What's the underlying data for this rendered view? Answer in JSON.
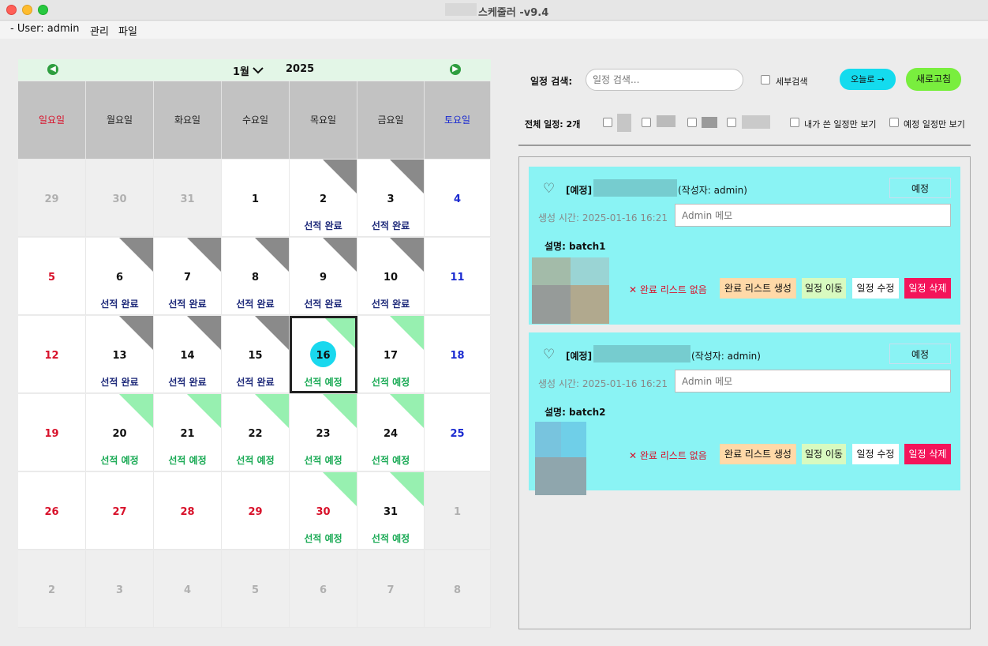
{
  "window": {
    "title": "스케줄러 -v9.4"
  },
  "menu": {
    "user": "- User: admin",
    "manage": "관리",
    "file": "파일"
  },
  "calendar": {
    "month": "1월",
    "year": "2025",
    "weekdays": [
      "일요일",
      "월요일",
      "화요일",
      "수요일",
      "목요일",
      "금요일",
      "토요일"
    ],
    "weeks": [
      [
        {
          "d": "29",
          "m": "other"
        },
        {
          "d": "30",
          "m": "other"
        },
        {
          "d": "31",
          "m": "other"
        },
        {
          "d": "1",
          "m": "cur"
        },
        {
          "d": "2",
          "m": "cur",
          "s": "선적 완료"
        },
        {
          "d": "3",
          "m": "cur",
          "s": "선적 완료"
        },
        {
          "d": "4",
          "m": "cur"
        }
      ],
      [
        {
          "d": "5",
          "m": "cur"
        },
        {
          "d": "6",
          "m": "cur",
          "s": "선적 완료"
        },
        {
          "d": "7",
          "m": "cur",
          "s": "선적 완료"
        },
        {
          "d": "8",
          "m": "cur",
          "s": "선적 완료"
        },
        {
          "d": "9",
          "m": "cur",
          "s": "선적 완료"
        },
        {
          "d": "10",
          "m": "cur",
          "s": "선적 완료"
        },
        {
          "d": "11",
          "m": "cur"
        }
      ],
      [
        {
          "d": "12",
          "m": "cur"
        },
        {
          "d": "13",
          "m": "cur",
          "s": "선적 완료"
        },
        {
          "d": "14",
          "m": "cur",
          "s": "선적 완료"
        },
        {
          "d": "15",
          "m": "cur",
          "s": "선적 완료"
        },
        {
          "d": "16",
          "m": "cur",
          "s": "선적 예정",
          "today": true
        },
        {
          "d": "17",
          "m": "cur",
          "s": "선적 예정"
        },
        {
          "d": "18",
          "m": "cur"
        }
      ],
      [
        {
          "d": "19",
          "m": "cur"
        },
        {
          "d": "20",
          "m": "cur",
          "s": "선적 예정"
        },
        {
          "d": "21",
          "m": "cur",
          "s": "선적 예정"
        },
        {
          "d": "22",
          "m": "cur",
          "s": "선적 예정"
        },
        {
          "d": "23",
          "m": "cur",
          "s": "선적 예정"
        },
        {
          "d": "24",
          "m": "cur",
          "s": "선적 예정"
        },
        {
          "d": "25",
          "m": "cur"
        }
      ],
      [
        {
          "d": "26",
          "m": "cur",
          "red": true
        },
        {
          "d": "27",
          "m": "cur",
          "red": true
        },
        {
          "d": "28",
          "m": "cur",
          "red": true
        },
        {
          "d": "29",
          "m": "cur",
          "red": true
        },
        {
          "d": "30",
          "m": "cur",
          "red": true,
          "s": "선적 예정"
        },
        {
          "d": "31",
          "m": "cur",
          "s": "선적 예정"
        },
        {
          "d": "1",
          "m": "other"
        }
      ],
      [
        {
          "d": "2",
          "m": "other"
        },
        {
          "d": "3",
          "m": "other"
        },
        {
          "d": "4",
          "m": "other"
        },
        {
          "d": "5",
          "m": "other"
        },
        {
          "d": "6",
          "m": "other"
        },
        {
          "d": "7",
          "m": "other"
        },
        {
          "d": "8",
          "m": "other"
        }
      ]
    ],
    "colors": {
      "done_text": "#1e2a7a",
      "plan_text": "#1aaa55",
      "done_corner": "#8a8a8a",
      "plan_corner": "#97f0b0",
      "today": "#19d8ee"
    }
  },
  "search": {
    "label": "일정 검색:",
    "placeholder": "일정 검색...",
    "detail_label": "세부검색",
    "today_button": "오늘로 →",
    "refresh_button": "새로고침"
  },
  "filters": {
    "total": "전체 일정: 2개",
    "mine_label": "내가 쓴 일정만 보기",
    "planned_label": "예정 일정만 보기"
  },
  "cards": [
    {
      "tag": "[예정]",
      "author": "(작성자: admin)",
      "status": "예정",
      "created": "생성 시간: 2025-01-16 16:21",
      "memo_placeholder": "Admin 메모",
      "desc": "설명: batch1",
      "no_list": "✕ 완료 리스트 없음",
      "btn_create": "완료 리스트 생성",
      "btn_move": "일정 이동",
      "btn_edit": "일정 수정",
      "btn_delete": "일정 삭제"
    },
    {
      "tag": "[예정]",
      "author": "(작성자: admin)",
      "status": "예정",
      "created": "생성 시간: 2025-01-16 16:21",
      "memo_placeholder": "Admin 메모",
      "desc": "설명: batch2",
      "no_list": "✕ 완료 리스트 없음",
      "btn_create": "완료 리스트 생성",
      "btn_move": "일정 이동",
      "btn_edit": "일정 수정",
      "btn_delete": "일정 삭제"
    }
  ],
  "icons": {
    "prev": "arrow-left-circle",
    "next": "arrow-right-circle",
    "dropdown": "chevron-down",
    "favorite": "heart-outline"
  }
}
